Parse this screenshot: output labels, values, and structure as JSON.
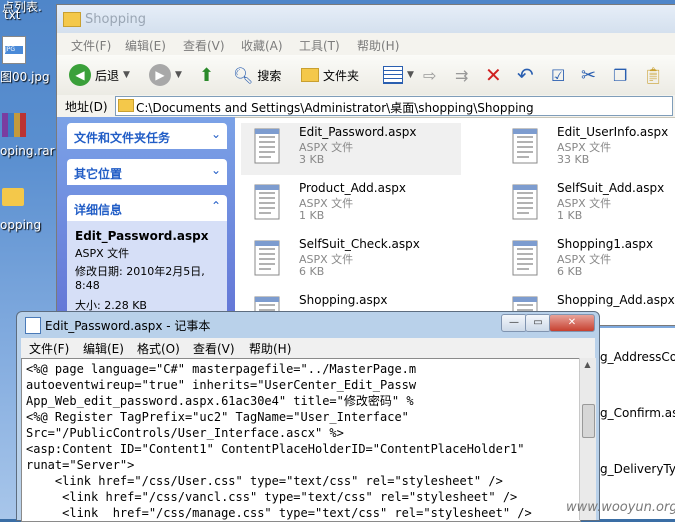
{
  "desktop": {
    "icons": [
      {
        "label": "点列表.",
        "sub": "txt"
      },
      {
        "label": "图00.jpg"
      },
      {
        "label": "oping.rar"
      },
      {
        "label": "opping"
      }
    ]
  },
  "explorer": {
    "title": "Shopping",
    "menu": [
      "文件(F)",
      "编辑(E)",
      "查看(V)",
      "收藏(A)",
      "工具(T)",
      "帮助(H)"
    ],
    "toolbar": {
      "back": "后退",
      "search": "搜索",
      "folders": "文件夹"
    },
    "address": {
      "label": "地址(D)",
      "path": "C:\\Documents and Settings\\Administrator\\桌面\\shopping\\Shopping"
    },
    "task_pane": {
      "sections": [
        "文件和文件夹任务",
        "其它位置",
        "详细信息"
      ],
      "detail": {
        "name": "Edit_Password.aspx",
        "type": "ASPX 文件",
        "modified": "修改日期: 2010年2月5日,",
        "time": "8:48",
        "size": "大小: 2.28 KB"
      }
    },
    "files": [
      {
        "name": "Edit_Password.aspx",
        "type": "ASPX 文件",
        "size": "3 KB"
      },
      {
        "name": "Edit_UserInfo.aspx",
        "type": "ASPX 文件",
        "size": "33 KB"
      },
      {
        "name": "Product_Add.aspx",
        "type": "ASPX 文件",
        "size": "1 KB"
      },
      {
        "name": "SelfSuit_Add.aspx",
        "type": "ASPX 文件",
        "size": "1 KB"
      },
      {
        "name": "SelfSuit_Check.aspx",
        "type": "ASPX 文件",
        "size": "6 KB"
      },
      {
        "name": "Shopping1.aspx",
        "type": "ASPX 文件",
        "size": "6 KB"
      },
      {
        "name": "Shopping.aspx",
        "type": "",
        "size": ""
      },
      {
        "name": "Shopping_Add.aspx",
        "type": "",
        "size": ""
      }
    ],
    "partial_right": [
      "g_AddressCon",
      "g_Confirm.asp",
      "g_DeliveryType"
    ]
  },
  "notepad": {
    "title": "Edit_Password.aspx - 记事本",
    "menu": [
      "文件(F)",
      "编辑(E)",
      "格式(O)",
      "查看(V)",
      "帮助(H)"
    ],
    "lines": [
      "<%@ page language=\"C#\" masterpagefile=\"../MasterPage.m",
      "autoeventwireup=\"true\" inherits=\"UserCenter_Edit_Passw",
      "App_Web_edit_password.aspx.61ac30e4\" title=\"修改密码\" %",
      "<%@ Register TagPrefix=\"uc2\" TagName=\"User_Interface\"",
      "Src=\"/PublicControls/User_Interface.ascx\" %>",
      "<asp:Content ID=\"Content1\" ContentPlaceHolderID=\"ContentPlaceHolder1\"",
      "runat=\"Server\">",
      "    <link href=\"/css/User.css\" type=\"text/css\" rel=\"stylesheet\" />",
      "     <link href=\"/css/vancl.css\" type=\"text/css\" rel=\"stylesheet\" />",
      "     <link  href=\"/css/manage.css\" type=\"text/css\" rel=\"stylesheet\" />"
    ]
  },
  "watermark": "www.wooyun.org"
}
